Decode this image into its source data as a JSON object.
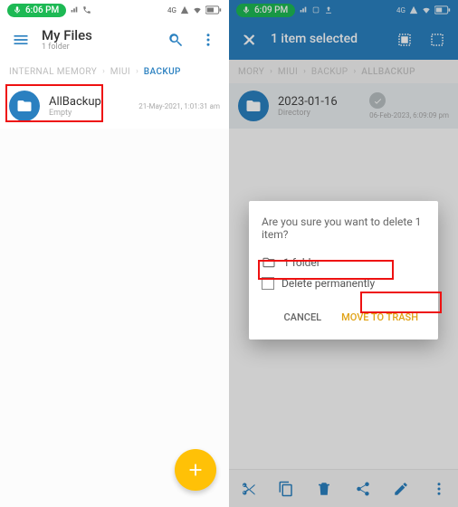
{
  "left": {
    "status": {
      "time": "6:06 PM"
    },
    "appbar": {
      "title": "My Files",
      "subtitle": "1 folder"
    },
    "crumbs": {
      "a": "INTERNAL MEMORY",
      "b": "MIUI",
      "c": "BACKUP"
    },
    "row": {
      "title": "AllBackup",
      "sub": "Empty",
      "date": "21-May-2021, 1:01:31 am"
    }
  },
  "right": {
    "status": {
      "time": "6:09 PM"
    },
    "appbar": {
      "title": "1 item selected"
    },
    "crumbs": {
      "a": "MORY",
      "b": "MIUI",
      "c": "BACKUP",
      "d": "ALLBACKUP"
    },
    "row": {
      "title": "2023-01-16",
      "sub": "Directory",
      "date": "06-Feb-2023, 6:09:09 pm"
    },
    "dialog": {
      "message": "Are you sure you want to delete 1 item?",
      "folder_line": "1 folder",
      "perm_label": "Delete permanently",
      "cancel": "CANCEL",
      "confirm": "MOVE TO TRASH"
    }
  }
}
